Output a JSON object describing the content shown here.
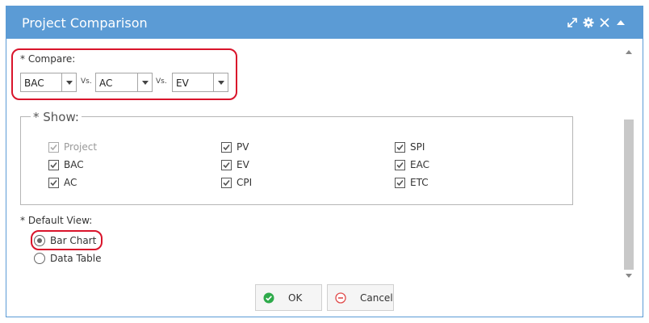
{
  "dialog": {
    "title": "Project Comparison",
    "icons": [
      "expand-icon",
      "gear-icon",
      "close-icon",
      "collapse-up-icon"
    ]
  },
  "compare": {
    "label": "* Compare:",
    "select1": "BAC",
    "vs1": "Vs.",
    "select2": "AC",
    "vs2": "Vs.",
    "select3": "EV"
  },
  "show": {
    "legend": "* Show:",
    "items": [
      {
        "label": "Project",
        "checked": true,
        "disabled": true
      },
      {
        "label": "BAC",
        "checked": true,
        "disabled": false
      },
      {
        "label": "AC",
        "checked": true,
        "disabled": false
      },
      {
        "label": "PV",
        "checked": true,
        "disabled": false
      },
      {
        "label": "EV",
        "checked": true,
        "disabled": false
      },
      {
        "label": "CPI",
        "checked": true,
        "disabled": false
      },
      {
        "label": "SPI",
        "checked": true,
        "disabled": false
      },
      {
        "label": "EAC",
        "checked": true,
        "disabled": false
      },
      {
        "label": "ETC",
        "checked": true,
        "disabled": false
      }
    ]
  },
  "default_view": {
    "label": "* Default View:",
    "options": [
      {
        "label": "Bar Chart",
        "selected": true
      },
      {
        "label": "Data Table",
        "selected": false
      }
    ]
  },
  "buttons": {
    "ok": "OK",
    "cancel": "Cancel"
  },
  "colors": {
    "titlebar": "#5b9bd5",
    "highlight": "#d9142b",
    "ok_icon": "#2eaa4a",
    "cancel_icon": "#e04b4b"
  }
}
